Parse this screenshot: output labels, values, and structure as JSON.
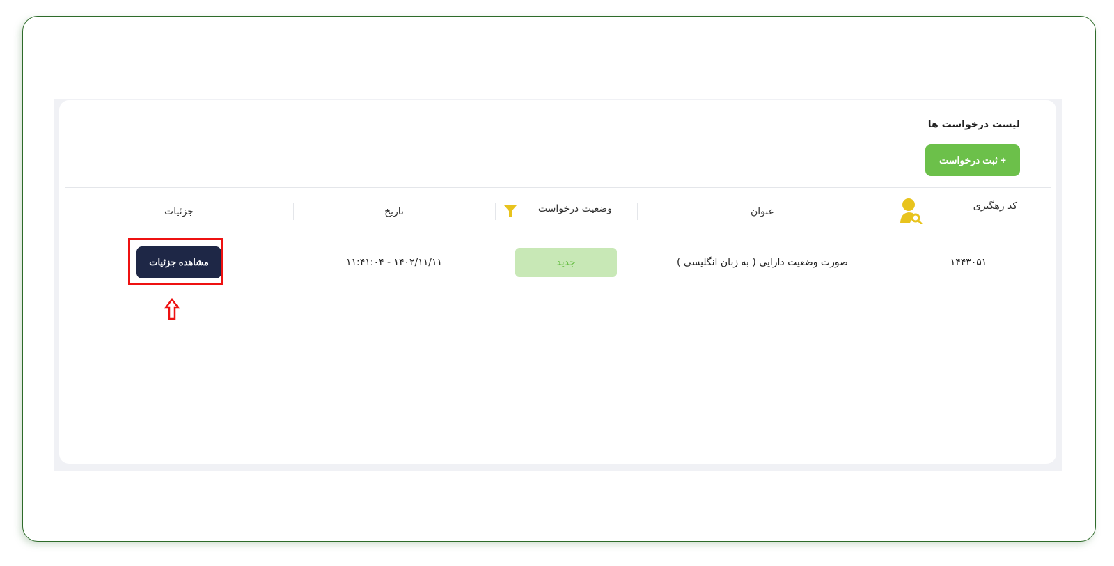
{
  "page": {
    "title": "لیست درخواست ها",
    "add_button_label": "+ ثبت درخواست"
  },
  "table": {
    "headers": {
      "tracking_code": "کد رهگیری",
      "title": "عنوان",
      "status": "وضعیت درخواست",
      "date": "تاریخ",
      "details": "جزئیات"
    },
    "rows": [
      {
        "tracking_code": "۱۴۴۳۰۵۱",
        "title": "صورت وضعیت دارایی ( به زبان انگلیسی )",
        "status": "جدید",
        "date": "۱۴۰۲/۱۱/۱۱ - ۱۱:۴۱:۰۴",
        "details_button": "مشاهده جزئیات"
      }
    ]
  },
  "colors": {
    "accent_green": "#6cc04a",
    "status_new_bg": "#c8e8b6",
    "details_button_bg": "#1e2746",
    "icon_yellow": "#e8c31d",
    "highlight_red": "#ee1111"
  },
  "icons": {
    "tracking_header": "user-search-icon",
    "status_filter": "filter-icon",
    "annotation": "up-arrow-icon"
  }
}
